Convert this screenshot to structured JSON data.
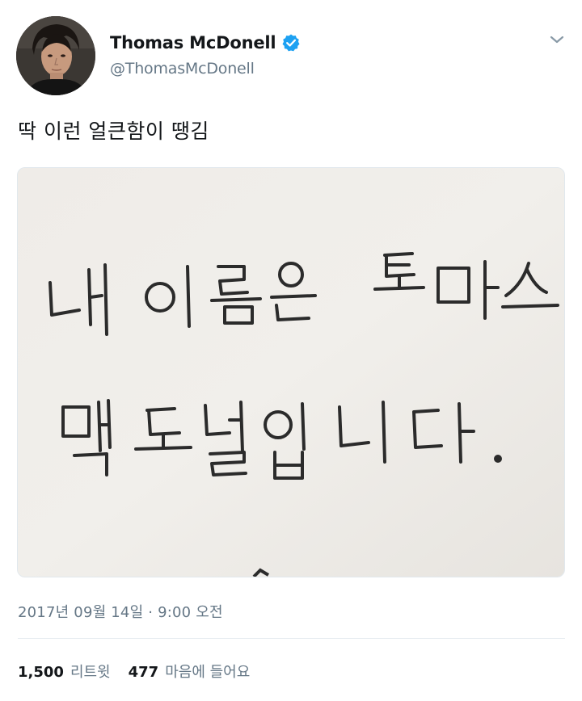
{
  "author": {
    "display_name": "Thomas McDonell",
    "handle": "@ThomasMcDonell",
    "verified": true
  },
  "tweet": {
    "text": "딱 이런 얼큰함이 땡김",
    "image_handwriting": [
      "내 이름은 토마스",
      "맥도널입니다."
    ],
    "timestamp": "2017년 09월 14일 · 9:00 오전"
  },
  "stats": {
    "retweets": {
      "count": "1,500",
      "label": "리트윗"
    },
    "likes": {
      "count": "477",
      "label": "마음에 들어요"
    }
  },
  "colors": {
    "verified": "#1da1f2",
    "secondary_text": "#657786",
    "primary_text": "#14171a",
    "divider": "#e6ecf0"
  },
  "icons": {
    "verified": "verified-badge-icon",
    "caret": "chevron-down-icon"
  }
}
